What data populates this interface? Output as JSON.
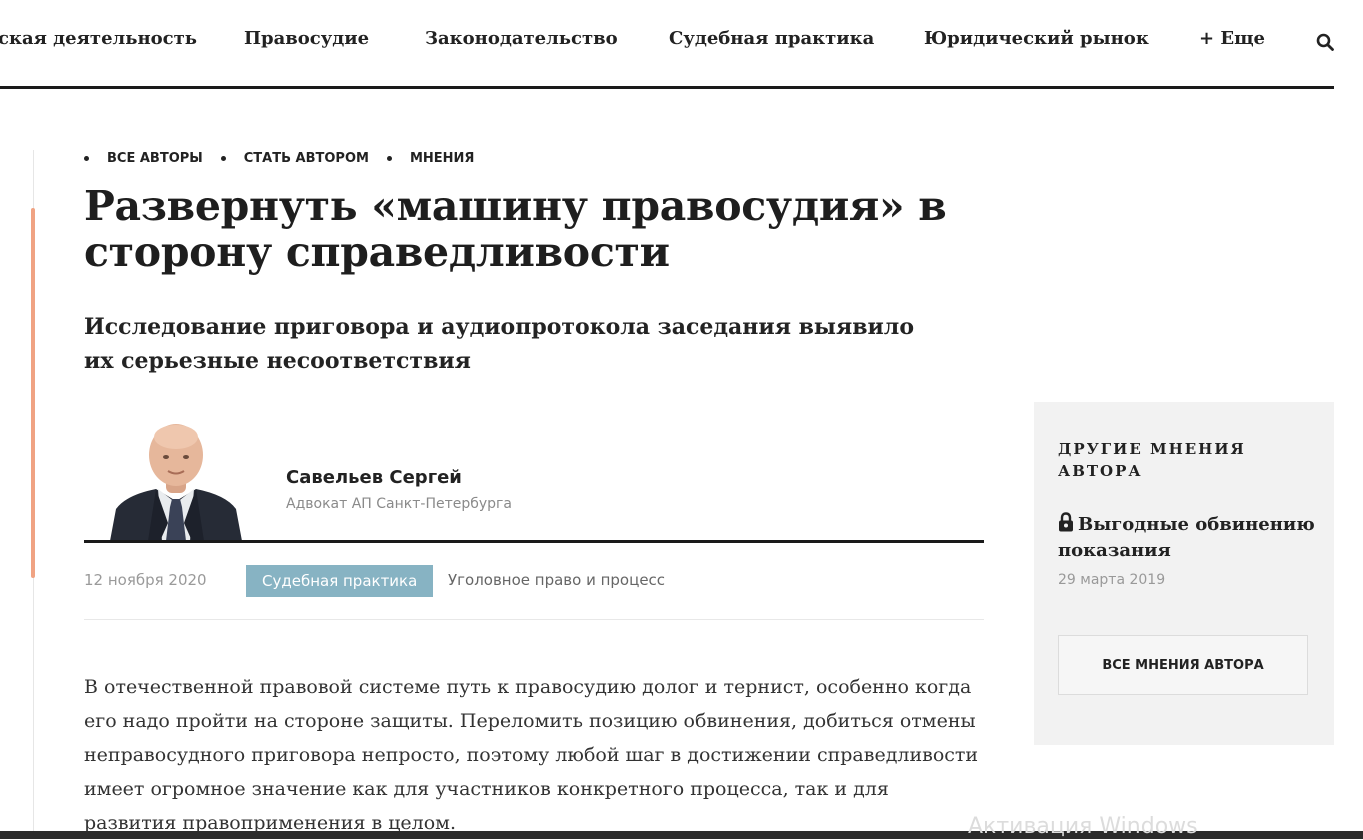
{
  "nav": {
    "items": [
      "ская деятельность",
      "Правосудие",
      "Законодательство",
      "Судебная практика",
      "Юридический рынок",
      "+ Еще"
    ],
    "search_icon": "search-icon"
  },
  "breadcrumbs": [
    "ВСЕ АВТОРЫ",
    "СТАТЬ АВТОРОМ",
    "МНЕНИЯ"
  ],
  "article": {
    "title": "Развернуть «машину правосудия» в сторону справедливости",
    "subtitle": "Исследование приговора и аудиопротокола заседания выявило их серьезные несоответствия",
    "author": {
      "name": "Савельев Сергей",
      "role": "Адвокат АП Санкт-Петербурга"
    },
    "date": "12 ноября 2020",
    "tag": "Судебная практика",
    "category": "Уголовное право и процесс",
    "body": "В отечественной правовой системе путь к правосудию долог и тернист, особенно когда его надо пройти на стороне защиты. Переломить позицию обвинения, добиться отмены неправосудного приговора непросто, поэтому любой шаг в достижении справедливости имеет огромное значение как для участников конкретного процесса, так и для развития правоприменения в целом."
  },
  "sidebar": {
    "heading": "ДРУГИЕ МНЕНИЯ АВТОРА",
    "article_title": "Выгодные обвинению показания",
    "article_date": "29 марта 2019",
    "button_label": "ВСЕ МНЕНИЯ АВТОРА",
    "lock_icon": "lock-icon"
  },
  "watermark": "Активация Windows",
  "colors": {
    "accent": "#f0a383",
    "tag_bg": "#87b3c3",
    "sidebar_bg": "#f2f2f2",
    "rule": "#1a1a1a"
  }
}
